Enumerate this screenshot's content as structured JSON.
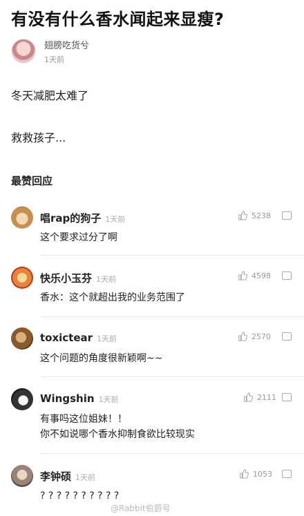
{
  "post": {
    "title": "有没有什么香水闻起来显瘦?",
    "author": {
      "name": "翅膀吃货兮",
      "time": "1天前"
    },
    "paragraphs": [
      "冬天减肥太难了",
      "救救孩子..."
    ]
  },
  "comments_section": {
    "title": "最赞回应",
    "comments": [
      {
        "name": "唱rap的狗子",
        "time": "1天前",
        "text": "这个要求过分了啊",
        "likes": "5238"
      },
      {
        "name": "快乐小玉芬",
        "time": "1天前",
        "text": "香水：这个就超出我的业务范围了",
        "likes": "4598"
      },
      {
        "name": "toxictear",
        "time": "1天前",
        "text": "这个问题的角度很新颖啊~~",
        "likes": "2570"
      },
      {
        "name": "Wingshin",
        "time": "1天前",
        "text": "有事吗这位姐妹！！",
        "text2": "你不如说哪个香水抑制食欲比较现实",
        "likes": "2111"
      },
      {
        "name": "李钟硕",
        "time": "1天前",
        "text": "? ? ? ? ? ? ? ? ? ?",
        "likes": "1053"
      }
    ]
  },
  "watermark": "@Rabbit伯爵号"
}
